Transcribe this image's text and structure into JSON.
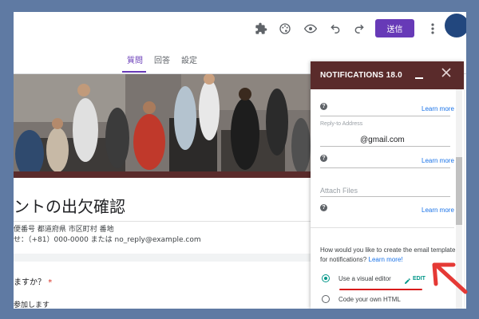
{
  "toolbar": {
    "send_label": "送信",
    "icons": [
      "puzzle-icon",
      "palette-icon",
      "eye-icon",
      "undo-icon",
      "redo-icon",
      "more-vert-icon"
    ]
  },
  "tabs": [
    {
      "label": "質問",
      "active": true
    },
    {
      "label": "回答",
      "active": false
    },
    {
      "label": "設定",
      "active": false
    }
  ],
  "form": {
    "title": "ントの出欠確認",
    "address_line": "便番号 都道府県 市区町村 番地",
    "contact_line": "せ：（+81）000-0000 または no_reply@example.com",
    "question": "ますか？",
    "required_mark": "*",
    "option1": "参加します"
  },
  "panel": {
    "title": "NOTIFICATIONS 18.0",
    "learn_more": "Learn more",
    "reply_to_label": "Reply-to Address",
    "reply_to_value": "@gmail.com",
    "attach_files_placeholder": "Attach Files",
    "template_question": "How would you like to create the email template for notifications?",
    "template_link": "Learn more!",
    "option_visual": "Use a visual editor",
    "option_visual_selected": true,
    "edit_label": "EDIT",
    "option_html": "Code your own HTML"
  },
  "colors": {
    "accent": "#673ab7",
    "panel_header": "#5a2b2b",
    "link": "#1a73e8",
    "teal": "#009688",
    "annotation_red": "#d81b1b",
    "background": "#5f7aa3"
  }
}
